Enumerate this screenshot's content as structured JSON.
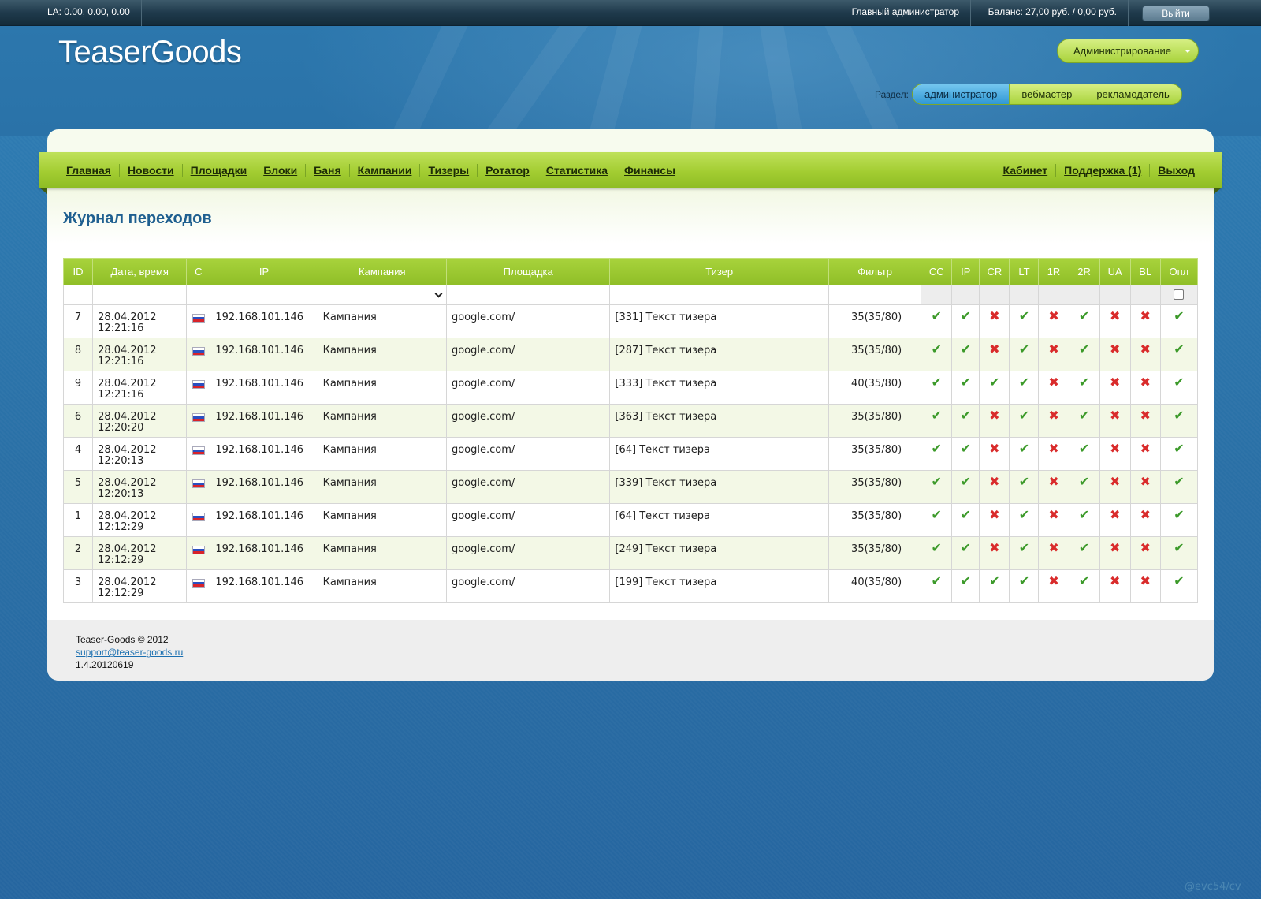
{
  "topbar": {
    "load_average": "LA: 0.00, 0.00, 0.00",
    "user_role": "Главный администратор",
    "balance": "Баланс: 27,00 руб. / 0,00 руб.",
    "logout_label": "Выйти"
  },
  "header": {
    "logo": "TeaserGoods",
    "admin_menu_label": "Администрирование",
    "section_label": "Раздел:",
    "sections": [
      "администратор",
      "вебмастер",
      "рекламодатель"
    ],
    "active_section": "администратор"
  },
  "nav": {
    "left": [
      "Главная",
      "Новости",
      "Площадки",
      "Блоки",
      "Баня",
      "Кампании",
      "Тизеры",
      "Ротатор",
      "Статистика",
      "Финансы"
    ],
    "right": [
      "Кабинет",
      "Поддержка (1)",
      "Выход"
    ]
  },
  "page_title": "Журнал переходов",
  "table": {
    "columns": [
      "ID",
      "Дата, время",
      "C",
      "IP",
      "Кампания",
      "Площадка",
      "Тизер",
      "Фильтр",
      "CC",
      "IP",
      "CR",
      "LT",
      "1R",
      "2R",
      "UA",
      "BL",
      "Опл"
    ],
    "rows": [
      {
        "id": "7",
        "date": "28.04.2012",
        "time": "12:21:16",
        "country": "ru",
        "ip": "192.168.101.146",
        "campaign": "Кампания",
        "site": "google.com/",
        "teaser": "[331] Текст тизера",
        "filter": "35(35/80)",
        "checks": [
          true,
          true,
          false,
          true,
          false,
          true,
          false,
          false,
          true
        ]
      },
      {
        "id": "8",
        "date": "28.04.2012",
        "time": "12:21:16",
        "country": "ru",
        "ip": "192.168.101.146",
        "campaign": "Кампания",
        "site": "google.com/",
        "teaser": "[287] Текст тизера",
        "filter": "35(35/80)",
        "checks": [
          true,
          true,
          false,
          true,
          false,
          true,
          false,
          false,
          true
        ]
      },
      {
        "id": "9",
        "date": "28.04.2012",
        "time": "12:21:16",
        "country": "ru",
        "ip": "192.168.101.146",
        "campaign": "Кампания",
        "site": "google.com/",
        "teaser": "[333] Текст тизера",
        "filter": "40(35/80)",
        "checks": [
          true,
          true,
          true,
          true,
          false,
          true,
          false,
          false,
          true
        ]
      },
      {
        "id": "6",
        "date": "28.04.2012",
        "time": "12:20:20",
        "country": "ru",
        "ip": "192.168.101.146",
        "campaign": "Кампания",
        "site": "google.com/",
        "teaser": "[363] Текст тизера",
        "filter": "35(35/80)",
        "checks": [
          true,
          true,
          false,
          true,
          false,
          true,
          false,
          false,
          true
        ]
      },
      {
        "id": "4",
        "date": "28.04.2012",
        "time": "12:20:13",
        "country": "ru",
        "ip": "192.168.101.146",
        "campaign": "Кампания",
        "site": "google.com/",
        "teaser": "[64] Текст тизера",
        "filter": "35(35/80)",
        "checks": [
          true,
          true,
          false,
          true,
          false,
          true,
          false,
          false,
          true
        ]
      },
      {
        "id": "5",
        "date": "28.04.2012",
        "time": "12:20:13",
        "country": "ru",
        "ip": "192.168.101.146",
        "campaign": "Кампания",
        "site": "google.com/",
        "teaser": "[339] Текст тизера",
        "filter": "35(35/80)",
        "checks": [
          true,
          true,
          false,
          true,
          false,
          true,
          false,
          false,
          true
        ]
      },
      {
        "id": "1",
        "date": "28.04.2012",
        "time": "12:12:29",
        "country": "ru",
        "ip": "192.168.101.146",
        "campaign": "Кампания",
        "site": "google.com/",
        "teaser": "[64] Текст тизера",
        "filter": "35(35/80)",
        "checks": [
          true,
          true,
          false,
          true,
          false,
          true,
          false,
          false,
          true
        ]
      },
      {
        "id": "2",
        "date": "28.04.2012",
        "time": "12:12:29",
        "country": "ru",
        "ip": "192.168.101.146",
        "campaign": "Кампания",
        "site": "google.com/",
        "teaser": "[249] Текст тизера",
        "filter": "35(35/80)",
        "checks": [
          true,
          true,
          false,
          true,
          false,
          true,
          false,
          false,
          true
        ]
      },
      {
        "id": "3",
        "date": "28.04.2012",
        "time": "12:12:29",
        "country": "ru",
        "ip": "192.168.101.146",
        "campaign": "Кампания",
        "site": "google.com/",
        "teaser": "[199] Текст тизера",
        "filter": "40(35/80)",
        "checks": [
          true,
          true,
          true,
          true,
          false,
          true,
          false,
          false,
          true
        ]
      }
    ],
    "icons": {
      "true": "check-icon",
      "false": "cross-icon"
    }
  },
  "footer": {
    "copyright": "Teaser-Goods © 2012",
    "email": "support@teaser-goods.ru",
    "version": "1.4.20120619"
  },
  "watermark": "@evc54/cv"
}
